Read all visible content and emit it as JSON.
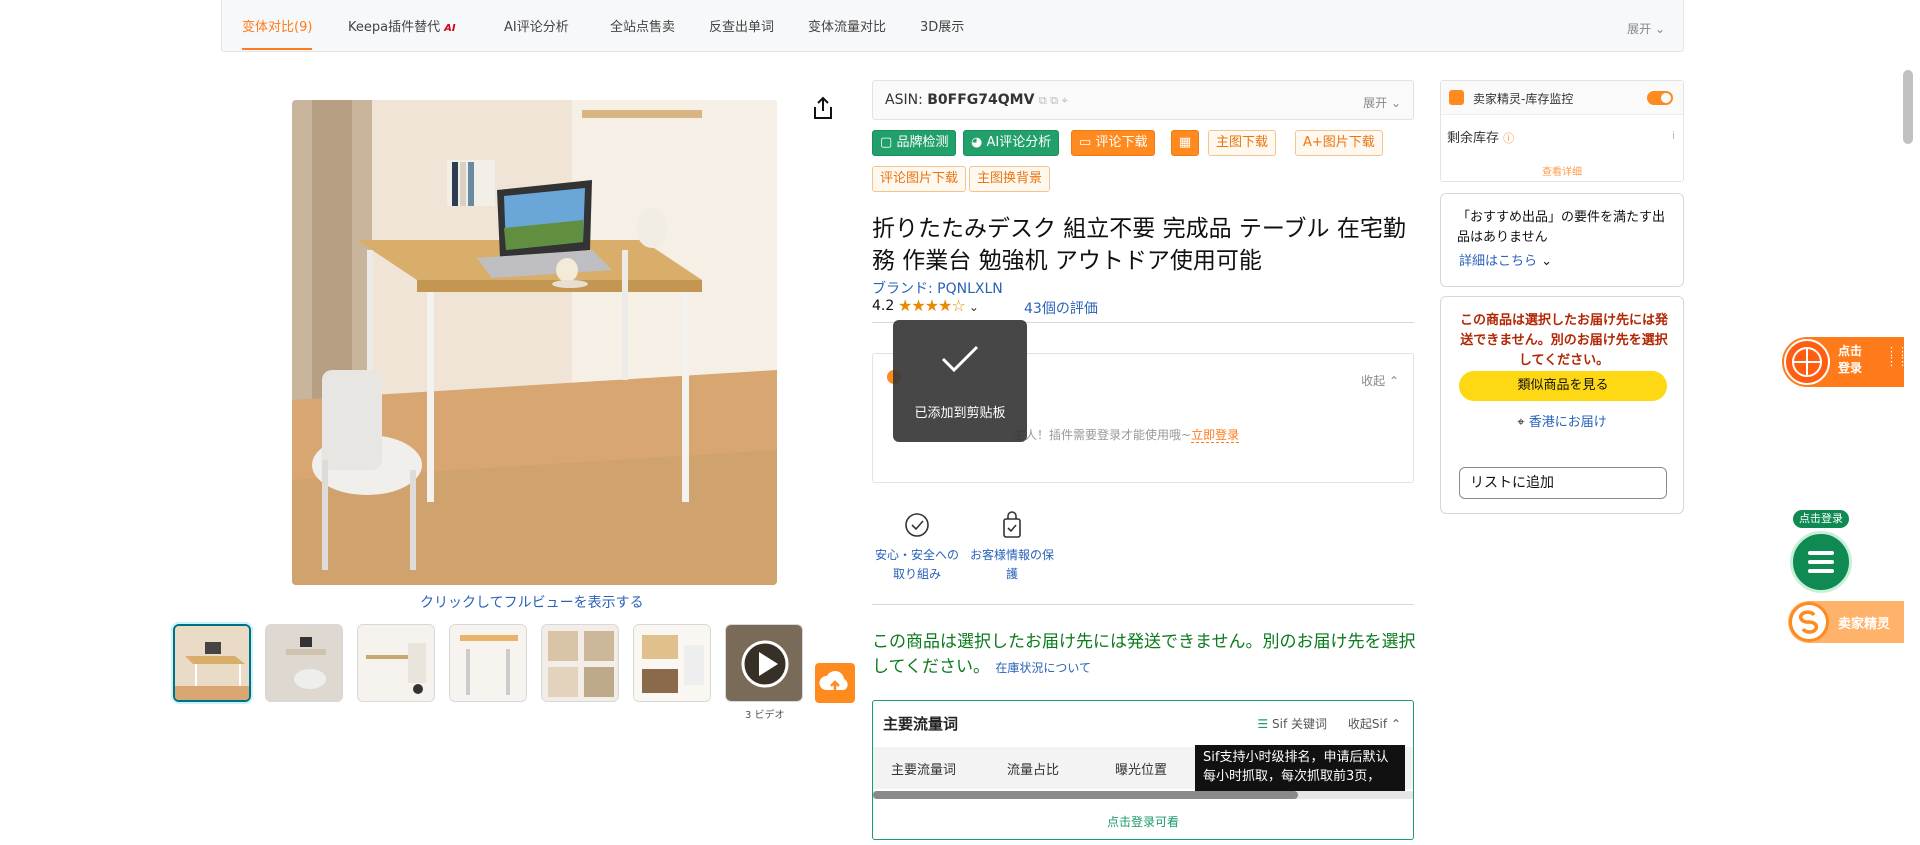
{
  "tabs": [
    {
      "label": "变体对比(9)",
      "active": true
    },
    {
      "label": "Keepa插件替代",
      "badge": "AI"
    },
    {
      "label": "AI评论分析"
    },
    {
      "label": "全站点售卖"
    },
    {
      "label": "反查出单词"
    },
    {
      "label": "变体流量对比"
    },
    {
      "label": "3D展示"
    }
  ],
  "tabbar_expand": "展开",
  "gallery": {
    "fullview_text": "クリックしてフルビューを表示する",
    "video_caption": "3 ビデオ"
  },
  "asin": {
    "label": "ASIN:",
    "value": "B0FFG74QMV",
    "expand": "展开"
  },
  "tools": {
    "brand_check": "品牌检测",
    "ai_review": "AI评论分析",
    "review_download": "评论下载",
    "main_image_download": "主图下载",
    "aplus_download": "A+图片下载",
    "review_image_download": "评论图片下载",
    "main_image_bg": "主图换背景"
  },
  "product": {
    "title": "折りたたみデスク 組立不要 完成品 テーブル 在宅勤務 作業台 勉強机 アウトドア使用可能",
    "brand": "ブランド: PQNLXLN",
    "rating": "4.2",
    "stars": "★★★★☆",
    "reviews": "43個の評価"
  },
  "login_panel": {
    "collapse": "收起",
    "tip": "主人！插件需要登录才能使用哦~",
    "login_link": "立即登录"
  },
  "toast": {
    "text": "已添加到剪贴板"
  },
  "trust": [
    {
      "label": "安心・安全への取り組み",
      "icon": "shield-check-icon"
    },
    {
      "label": "お客様情報の保護",
      "icon": "lock-bag-icon"
    }
  ],
  "shipping": {
    "message": "この商品は選択したお届け先には発送できません。別のお届け先を選択してください。",
    "stock_link": "在庫状況について"
  },
  "keywords": {
    "title": "主要流量词",
    "sif": "Sif 关键词",
    "collapse": "收起Sif",
    "columns": [
      "主要流量词",
      "流量占比",
      "曝光位置"
    ],
    "tooltip_line1": "Sif支持小时级排名，申请后默认",
    "tooltip_line2": "每小时抓取，每次抓取前3页，",
    "login": "点击登录可看"
  },
  "stock_monitor": {
    "title": "卖家精灵-库存监控",
    "remaining": "剩余库存",
    "detail": "查看详细"
  },
  "recommend": {
    "text": "「おすすめ出品」の要件を満たす出品はありません",
    "link": "詳細はこちら"
  },
  "buy_box": {
    "warning": "この商品は選択したお届け先には発送できません。別のお届け先を選択してください。",
    "similar": "類似商品を見る",
    "deliver": "香港にお届け",
    "add_list": "リストに追加"
  },
  "floating": {
    "login_line1": "点击",
    "login_line2": "登录",
    "green_badge": "点击登录",
    "seller": "卖家精灵"
  },
  "colors": {
    "accent": "#ff7a1a",
    "green": "#22a06b",
    "link": "#2a62b8"
  }
}
